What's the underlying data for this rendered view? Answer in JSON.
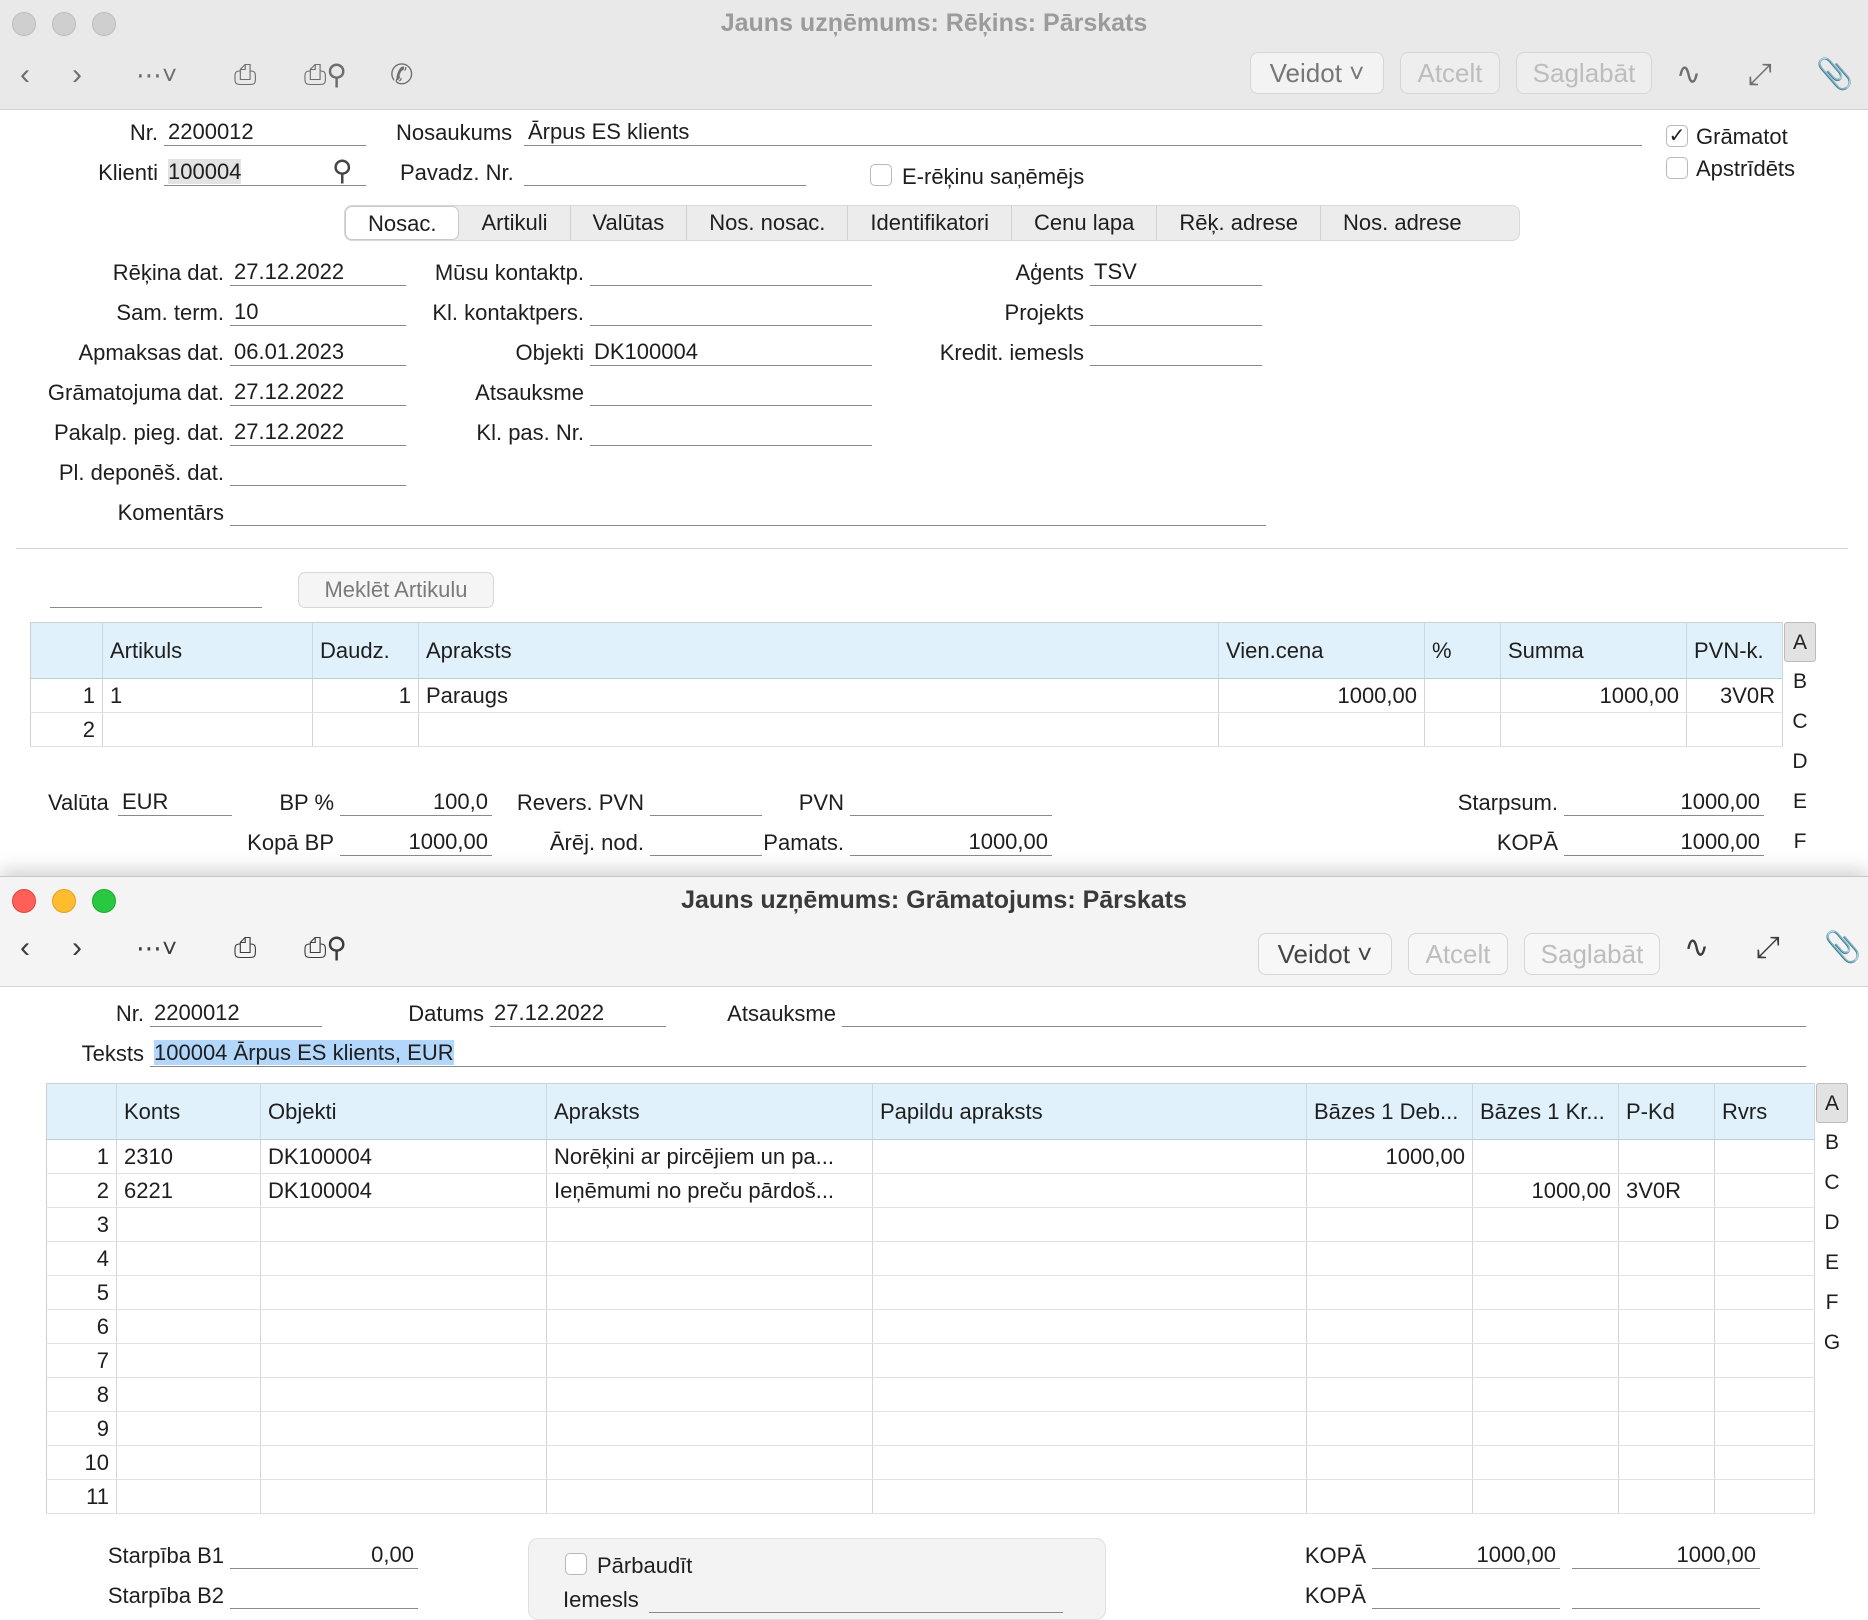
{
  "invoice": {
    "title": "Jauns uzņēmums: Rēķins: Pārskats",
    "toolbar": {
      "create": "Veidot",
      "cancel": "Atcelt",
      "save": "Saglabāt"
    },
    "header": {
      "nr_label": "Nr.",
      "nr": "2200012",
      "name_label": "Nosaukums",
      "name": "Ārpus ES klients",
      "client_label": "Klienti",
      "client": "100004",
      "delivery_label": "Pavadz. Nr.",
      "delivery": "",
      "erek_label": "E-rēķinu saņēmējs",
      "book_label": "Grāmatot",
      "book_checked": true,
      "approved_label": "Apstrīdēts"
    },
    "tabs": [
      "Nosac.",
      "Artikuli",
      "Valūtas",
      "Nos. nosac.",
      "Identifikatori",
      "Cenu lapa",
      "Rēķ. adrese",
      "Nos. adrese"
    ],
    "fields": {
      "invoice_date_label": "Rēķina dat.",
      "invoice_date": "27.12.2022",
      "pay_term_label": "Sam. term.",
      "pay_term": "10",
      "pay_date_label": "Apmaksas dat.",
      "pay_date": "06.01.2023",
      "book_date_label": "Grāmatojuma dat.",
      "book_date": "27.12.2022",
      "service_date_label": "Pakalp. pieg. dat.",
      "service_date": "27.12.2022",
      "deposit_date_label": "Pl. deponēš. dat.",
      "deposit_date": "",
      "comment_label": "Komentārs",
      "comment": "",
      "our_contact_label": "Mūsu kontaktp.",
      "our_contact": "",
      "client_contact_label": "Kl. kontaktpers.",
      "client_contact": "",
      "objects_label": "Objekti",
      "objects": "DK100004",
      "reference_label": "Atsauksme",
      "reference": "",
      "order_label": "Kl. pas. Nr.",
      "order": "",
      "agent_label": "Aģents",
      "agent": "TSV",
      "project_label": "Projekts",
      "project": "",
      "credit_label": "Kredit. iemesls",
      "credit": ""
    },
    "search_button": "Meklēt Artikulu",
    "table": {
      "headers": [
        "",
        "Artikuls",
        "Daudz.",
        "Apraksts",
        "Vien.cena",
        "%",
        "Summa",
        "PVN-k."
      ],
      "rows": [
        [
          "1",
          "1",
          "1",
          "Paraugs",
          "1000,00",
          "",
          "1000,00",
          "3V0R"
        ],
        [
          "2",
          "",
          "",
          "",
          "",
          "",
          "",
          ""
        ]
      ]
    },
    "side": [
      "A",
      "B",
      "C",
      "D",
      "E",
      "F"
    ],
    "totals": {
      "currency_label": "Valūta",
      "currency": "EUR",
      "bp_label": "BP %",
      "bp": "100,0",
      "revers_label": "Revers. PVN",
      "revers": "",
      "vat_label": "PVN",
      "vat": "",
      "subtotal_label": "Starpsum.",
      "subtotal": "1000,00",
      "total_bp_label": "Kopā BP",
      "total_bp": "1000,00",
      "ext_label": "Ārēj. nod.",
      "ext": "",
      "base_label": "Pamats.",
      "base": "1000,00",
      "total_label": "KOPĀ",
      "total": "1000,00"
    }
  },
  "entry": {
    "title": "Jauns uzņēmums: Grāmatojums: Pārskats",
    "toolbar": {
      "create": "Veidot",
      "cancel": "Atcelt",
      "save": "Saglabāt"
    },
    "header": {
      "nr_label": "Nr.",
      "nr": "2200012",
      "date_label": "Datums",
      "date": "27.12.2022",
      "ref_label": "Atsauksme",
      "ref": "",
      "text_label": "Teksts",
      "text": "100004 Ārpus ES klients, EUR "
    },
    "table": {
      "headers": [
        "",
        "Konts",
        "Objekti",
        "Apraksts",
        "Papildu apraksts",
        "Bāzes 1 Deb...",
        "Bāzes 1 Kr...",
        "P-Kd",
        "Rvrs"
      ],
      "rows": [
        [
          "1",
          "2310",
          "DK100004",
          "Norēķini ar pircējiem un pa...",
          "",
          "1000,00",
          "",
          "",
          ""
        ],
        [
          "2",
          "6221",
          "DK100004",
          "Ieņēmumi no preču pārdoš...",
          "",
          "",
          "1000,00",
          "3V0R",
          ""
        ],
        [
          "3",
          "",
          "",
          "",
          "",
          "",
          "",
          "",
          ""
        ],
        [
          "4",
          "",
          "",
          "",
          "",
          "",
          "",
          "",
          ""
        ],
        [
          "5",
          "",
          "",
          "",
          "",
          "",
          "",
          "",
          ""
        ],
        [
          "6",
          "",
          "",
          "",
          "",
          "",
          "",
          "",
          ""
        ],
        [
          "7",
          "",
          "",
          "",
          "",
          "",
          "",
          "",
          ""
        ],
        [
          "8",
          "",
          "",
          "",
          "",
          "",
          "",
          "",
          ""
        ],
        [
          "9",
          "",
          "",
          "",
          "",
          "",
          "",
          "",
          ""
        ],
        [
          "10",
          "",
          "",
          "",
          "",
          "",
          "",
          "",
          ""
        ],
        [
          "11",
          "",
          "",
          "",
          "",
          "",
          "",
          "",
          ""
        ]
      ]
    },
    "side": [
      "A",
      "B",
      "C",
      "D",
      "E",
      "F",
      "G"
    ],
    "footer": {
      "diff_b1_label": "Starpība B1",
      "diff_b1": "0,00",
      "diff_b2_label": "Starpība B2",
      "diff_b2": "",
      "check_label": "Pārbaudīt",
      "reason_label": "Iemesls",
      "reason": "",
      "total1_label": "KOPĀ",
      "total1_debit": "1000,00",
      "total1_credit": "1000,00",
      "total2_label": "KOPĀ",
      "total2_debit": "",
      "total2_credit": ""
    }
  }
}
